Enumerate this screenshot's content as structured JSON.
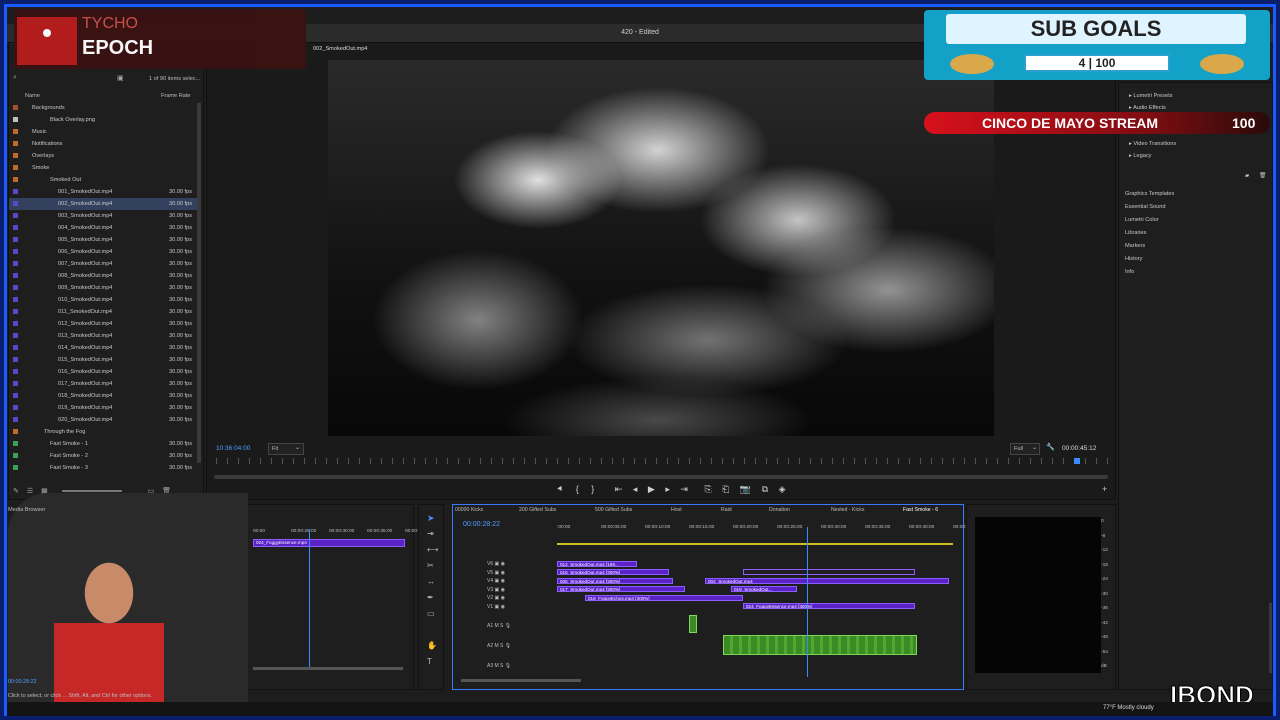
{
  "window": {
    "title": "420 - Edited"
  },
  "overlay": {
    "channel_top": "TYCHO",
    "channel_bottom": "EPOCH",
    "sub_goals_title": "SUB GOALS",
    "sub_goals_current": "4",
    "sub_goals_target": "100",
    "stream_title": "CINCO DE MAYO STREAM",
    "stream_value": "100",
    "watermark": "IBOND"
  },
  "project": {
    "items_count": "1 of 90 items selec...",
    "col_name": "Name",
    "col_frame_rate": "Frame Rate",
    "folders": [
      {
        "label": "Backgrounds",
        "color": "#a0522d"
      },
      {
        "label": "Black Overlay.png",
        "color": "#c0c0c0"
      },
      {
        "label": "Music",
        "color": "#c06a2a"
      },
      {
        "label": "Notifications",
        "color": "#c06a2a"
      },
      {
        "label": "Overlays",
        "color": "#c06a2a"
      },
      {
        "label": "Smoke",
        "color": "#c06a2a"
      },
      {
        "label": "Smoked Out",
        "color": "#c06a2a"
      }
    ],
    "clips": [
      {
        "label": "001_SmokedOut.mp4",
        "fps": "30.00 fps"
      },
      {
        "label": "002_SmokedOut.mp4",
        "fps": "30.00 fps"
      },
      {
        "label": "003_SmokedOut.mp4",
        "fps": "30.00 fps"
      },
      {
        "label": "004_SmokedOut.mp4",
        "fps": "30.00 fps"
      },
      {
        "label": "005_SmokedOut.mp4",
        "fps": "30.00 fps"
      },
      {
        "label": "006_SmokedOut.mp4",
        "fps": "30.00 fps"
      },
      {
        "label": "007_SmokedOut.mp4",
        "fps": "30.00 fps"
      },
      {
        "label": "008_SmokedOut.mp4",
        "fps": "30.00 fps"
      },
      {
        "label": "009_SmokedOut.mp4",
        "fps": "30.00 fps"
      },
      {
        "label": "010_SmokedOut.mp4",
        "fps": "30.00 fps"
      },
      {
        "label": "011_SmokedOut.mp4",
        "fps": "30.00 fps"
      },
      {
        "label": "012_SmokedOut.mp4",
        "fps": "30.00 fps"
      },
      {
        "label": "013_SmokedOut.mp4",
        "fps": "30.00 fps"
      },
      {
        "label": "014_SmokedOut.mp4",
        "fps": "30.00 fps"
      },
      {
        "label": "015_SmokedOut.mp4",
        "fps": "30.00 fps"
      },
      {
        "label": "016_SmokedOut.mp4",
        "fps": "30.00 fps"
      },
      {
        "label": "017_SmokedOut.mp4",
        "fps": "30.00 fps"
      },
      {
        "label": "018_SmokedOut.mp4",
        "fps": "30.00 fps"
      },
      {
        "label": "019_SmokedOut.mp4",
        "fps": "30.00 fps"
      },
      {
        "label": "020_SmokedOut.mp4",
        "fps": "30.00 fps"
      }
    ],
    "after": [
      {
        "label": "Through the Fog",
        "fps": ""
      },
      {
        "label": "Fast Smoke - 1",
        "fps": "30.00 fps"
      },
      {
        "label": "Fast Smoke - 2",
        "fps": "30.00 fps"
      },
      {
        "label": "Fast Smoke - 3",
        "fps": "30.00 fps"
      }
    ]
  },
  "program": {
    "tab": "002_SmokedOut.mp4",
    "timecode_left": "10:36:04:00",
    "zoom": "Fit",
    "quality": "Full",
    "timecode_right": "00:00:45:12"
  },
  "timeline": {
    "tabs": [
      "00000 Kicks",
      "200 Gifted Subs",
      "500 Gifted Subs",
      "Host",
      "Raid",
      "Donation",
      "Nested - Kicks",
      "Fast Smoke - 6"
    ],
    "timecode": "00:00:28:22",
    "ruler": [
      ":00:00",
      "00:00:05:00",
      "00:00:10:00",
      "00:00:15:00",
      "00:00:20:00",
      "00:00:25:00",
      "00:00:30:00",
      "00:00:35:00",
      "00:00:40:00",
      "00:00:"
    ],
    "video_tracks": [
      "V6",
      "V5",
      "V4",
      "V3",
      "V2",
      "V1"
    ],
    "audio_tracks": [
      "A1",
      "A2",
      "A3"
    ],
    "clips": [
      "012_SmokedOut.mp4 [199...",
      "016_SmokedOut.mp4 [300%]",
      "005_SmokedOut.mp4 [300%]",
      "002_SmokedOut.mp4",
      "017_SmokedOut.mp4 [300%]",
      "019_SmokedOut...",
      "018_FoggyEchos.mp4 [300%]",
      "024_FoggyEssence.mp4 [300%]"
    ]
  },
  "source": {
    "clip": "024_FoggyEssence.mp4",
    "ruler": [
      "00:00",
      "00:00:25:00",
      "00:00:30:00",
      "00:00:35:00",
      "00:00:40:"
    ],
    "media_browser": "Media Browser",
    "timecode": "00:00:28:22",
    "status": "Click to select, or click ... Shift, Alt, and Ctrl for other options."
  },
  "effects": {
    "items": [
      "Lumetri Presets",
      "Audio Effects",
      "Video Transitions",
      "Legacy"
    ]
  },
  "right_panels": [
    "Graphics Templates",
    "Essential Sound",
    "Lumetri Color",
    "Libraries",
    "Markers",
    "History",
    "Info"
  ],
  "meter_ticks": [
    "0",
    "-6",
    "-12",
    "-18",
    "-24",
    "-30",
    "-36",
    "-42",
    "-48",
    "-54",
    "dB"
  ],
  "weather": "77°F Mostly cloudy"
}
